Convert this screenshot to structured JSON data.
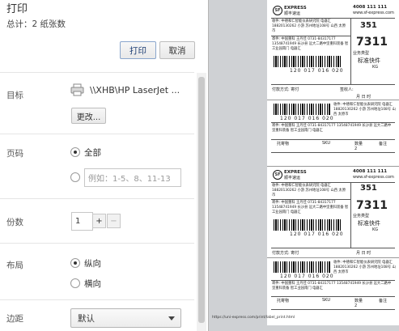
{
  "header": {
    "title": "打印",
    "total": "总计：2 纸张数",
    "print_label": "打印",
    "cancel_label": "取消"
  },
  "settings": {
    "destination": {
      "label": "目标",
      "printer": "\\\\XHB\\HP LaserJet ...",
      "change_label": "更改..."
    },
    "pages": {
      "label": "页码",
      "all_label": "全部",
      "custom_placeholder": "例如：1-5、8、11-13",
      "selected": "all"
    },
    "copies": {
      "label": "份数",
      "value": "1",
      "plus": "+",
      "minus": "−"
    },
    "layout": {
      "label": "布局",
      "portrait_label": "纵向",
      "landscape_label": "横向",
      "selected": "portrait"
    },
    "margins": {
      "label": "边距",
      "value": "默认"
    }
  },
  "preview": {
    "phone": "4008 111 111",
    "url": "www.sf-express.com",
    "brand_en": "EXPRESS",
    "brand_cn": "顺丰速运",
    "code1": "351",
    "code2": "7311",
    "service_label": "业务类型",
    "service_value": "标准快件",
    "weight_unit": "KG",
    "billing_label": "寄件人",
    "receiver_block": "收件: 中德和仁智能仪表研究院 电器汇 18820130262 小游 苏州地址108号 山西 太原市",
    "sender_block": "寄件: 中国重科 王丹佳 0731-84317177 13548741949 长沙县 远大二路中坚重科装备 智工业园南门 电器汇",
    "tracking": "120 017 016 020",
    "pay_label": "付款方式: 寄付",
    "sign_label": "签收人:",
    "date_label": "月    日    时",
    "item_label": "托寄物",
    "qty_label": "SKU",
    "qty2_label": "数量",
    "remark_label": "备注",
    "note_value": "2",
    "footer_url": "https://uni-express.com/print/label_print.html",
    "colors": {
      "page_bg": "#ffffff",
      "panel_bg": "#cfd1d4"
    }
  }
}
